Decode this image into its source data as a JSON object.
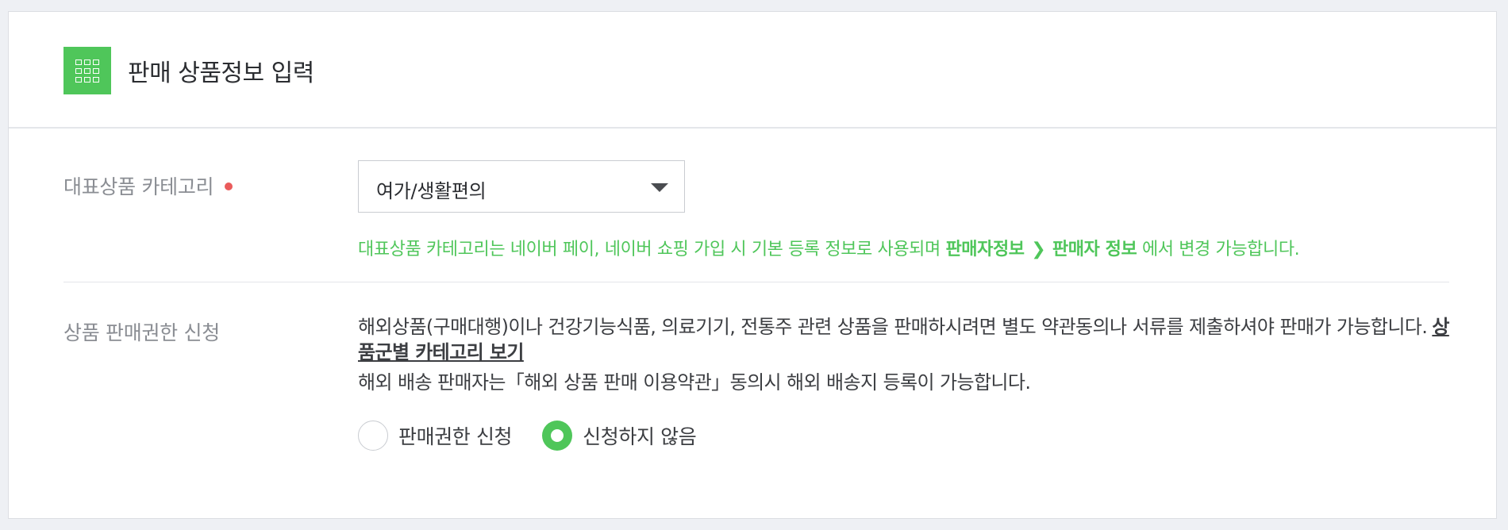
{
  "header": {
    "title": "판매 상품정보 입력",
    "icon": "grid-icon",
    "accent_color": "#4fc65a"
  },
  "category": {
    "label": "대표상품 카테고리",
    "required_color": "#ea5b5b",
    "selected_value": "여가/생활편의",
    "notice": {
      "prefix": "대표상품 카테고리는 네이버 페이, 네이버 쇼핑 가입 시 기본 등록 정보로 사용되며",
      "path_part1": "판매자정보",
      "path_separator": "❯",
      "path_part2": "판매자 정보",
      "suffix": "에서 변경 가능합니다."
    }
  },
  "permission": {
    "label": "상품 판매권한 신청",
    "description": "해외상품(구매대행)이나 건강기능식품, 의료기기, 전통주 관련 상품을 판매하시려면 별도 약관동의나 서류를 제출하셔야 판매가 가능합니다.",
    "link_label": "상품군별 카테고리 보기",
    "overseas_notice": "해외 배송 판매자는「해외 상품 판매 이용약관」동의시 해외 배송지 등록이 가능합니다.",
    "options": [
      {
        "label": "판매권한 신청",
        "selected": false
      },
      {
        "label": "신청하지 않음",
        "selected": true
      }
    ]
  }
}
